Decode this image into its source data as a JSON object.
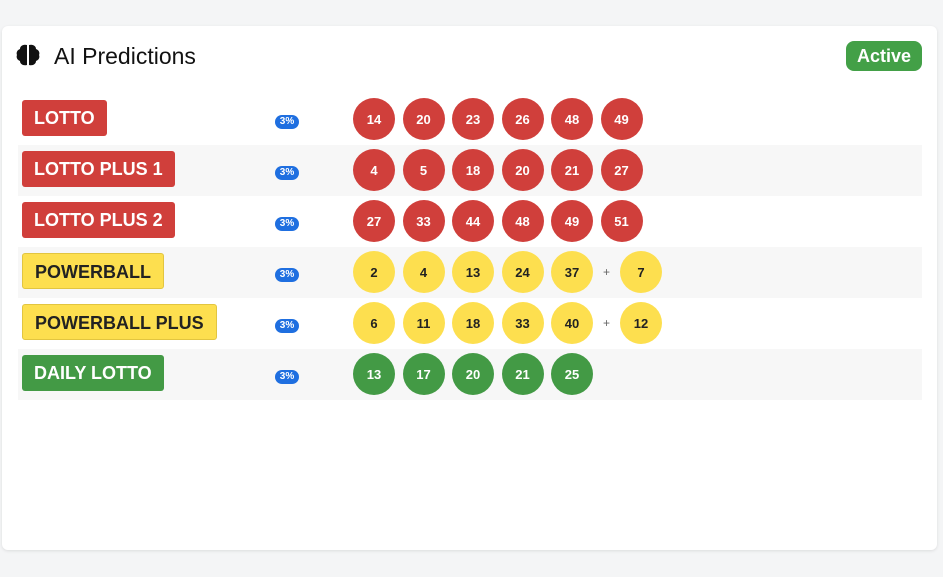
{
  "header": {
    "title": "AI Predictions",
    "status": "Active",
    "icon": "brain-icon"
  },
  "colors": {
    "red": "#d03f3b",
    "yellow": "#fddf4f",
    "green": "#439a45",
    "accent_blue": "#1f6fe0",
    "active_green": "#43a047"
  },
  "games": [
    {
      "name": "LOTTO",
      "color": "red",
      "percent": "3%",
      "numbers": [
        "14",
        "20",
        "23",
        "26",
        "48",
        "49"
      ],
      "bonus": null
    },
    {
      "name": "LOTTO PLUS 1",
      "color": "red",
      "percent": "3%",
      "numbers": [
        "4",
        "5",
        "18",
        "20",
        "21",
        "27"
      ],
      "bonus": null
    },
    {
      "name": "LOTTO PLUS 2",
      "color": "red",
      "percent": "3%",
      "numbers": [
        "27",
        "33",
        "44",
        "48",
        "49",
        "51"
      ],
      "bonus": null
    },
    {
      "name": "POWERBALL",
      "color": "yellow",
      "percent": "3%",
      "numbers": [
        "2",
        "4",
        "13",
        "24",
        "37"
      ],
      "bonus": "7"
    },
    {
      "name": "POWERBALL PLUS",
      "color": "yellow",
      "percent": "3%",
      "numbers": [
        "6",
        "11",
        "18",
        "33",
        "40"
      ],
      "bonus": "12"
    },
    {
      "name": "DAILY LOTTO",
      "color": "green",
      "percent": "3%",
      "numbers": [
        "13",
        "17",
        "20",
        "21",
        "25"
      ],
      "bonus": null
    }
  ]
}
